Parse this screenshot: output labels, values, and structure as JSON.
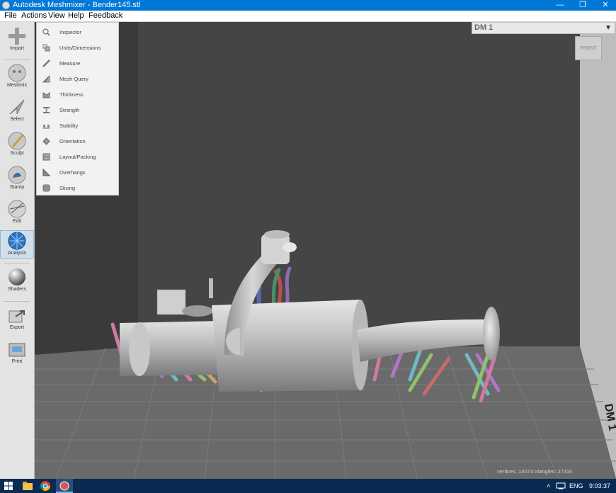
{
  "window": {
    "title": "Autodesk Meshmixer - Bender145.stl"
  },
  "menu": [
    "File",
    "Actions",
    "View",
    "Help",
    "Feedback"
  ],
  "tools": [
    {
      "label": "Import",
      "icon": "plus-icon"
    },
    {
      "label": "Meshmix",
      "icon": "meshmix-icon"
    },
    {
      "label": "Select",
      "icon": "select-arrow-icon"
    },
    {
      "label": "Sculpt",
      "icon": "sculpt-brush-icon"
    },
    {
      "label": "Stamp",
      "icon": "stamp-icon"
    },
    {
      "label": "Edit",
      "icon": "edit-icon"
    },
    {
      "label": "Analysis",
      "icon": "analysis-icon"
    },
    {
      "label": "Shaders",
      "icon": "shaders-icon"
    },
    {
      "label": "Export",
      "icon": "export-icon"
    },
    {
      "label": "Print",
      "icon": "print-icon"
    }
  ],
  "analysis_menu": [
    "Inspector",
    "Units/Dimensions",
    "Measure",
    "Mesh Query",
    "Thickness",
    "Strength",
    "Stability",
    "Orientation",
    "Layout/Packing",
    "Overhangs",
    "Slicing"
  ],
  "object": {
    "name": "DM 1"
  },
  "viewcube": {
    "face": "FRONT"
  },
  "plate_label": "DM 1",
  "status": "vertices: 14073 triangles: 27310",
  "taskbar": {
    "lang": "ENG",
    "time": "9:03:37"
  },
  "colors": {
    "titlebar": "#0078d7",
    "toolbar": "#e3e3e3",
    "viewport": "#3e3e3e",
    "taskbar": "#0a2a52",
    "accent": "#9bb8cc"
  }
}
